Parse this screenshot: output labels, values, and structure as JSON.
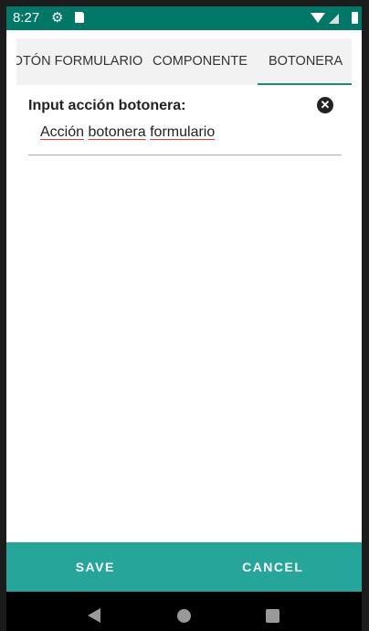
{
  "status_bar": {
    "time": "8:27"
  },
  "tabs": [
    {
      "label": "BOTÓN FORMULARIO"
    },
    {
      "label": "COMPONENTE"
    },
    {
      "label": "BOTONERA",
      "selected": true
    }
  ],
  "form": {
    "label": "Input acción botonera:",
    "words": [
      "Acción",
      "botonera",
      "formulario"
    ],
    "clear_icon": "close-circle-icon"
  },
  "buttons": {
    "save": "SAVE",
    "cancel": "CANCEL"
  },
  "colors": {
    "status": "#017767",
    "accent": "#26a69a"
  }
}
